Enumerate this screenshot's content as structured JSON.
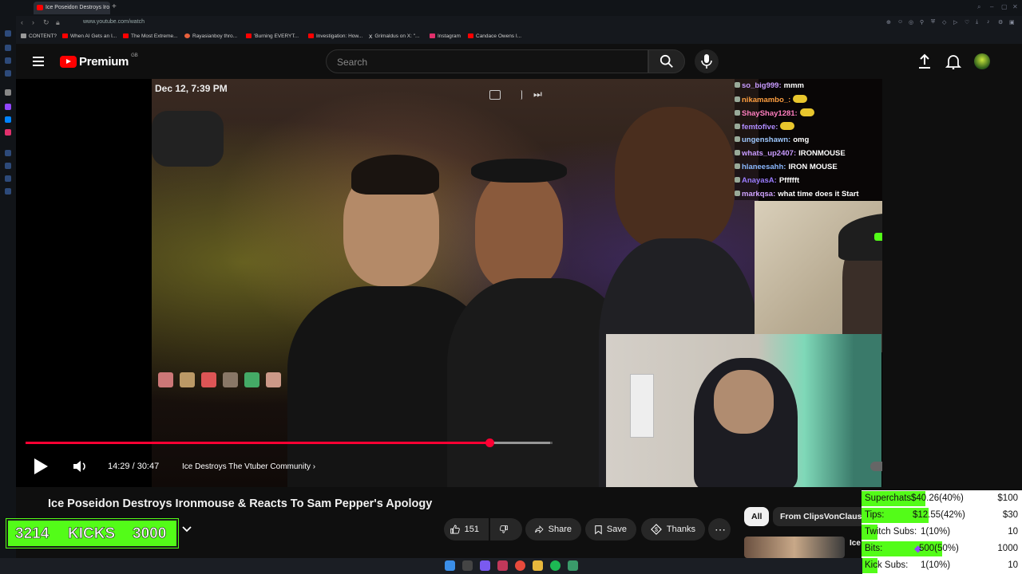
{
  "browser": {
    "tab_title": "Ice Poseidon Destroys Iro",
    "url": "www.youtube.com/watch",
    "bookmarks": [
      {
        "label": "CONTENT?",
        "color": "#bbbbbb"
      },
      {
        "label": "When AI Gets an I...",
        "color": "#ff0000"
      },
      {
        "label": "The Most Extreme...",
        "color": "#ff0000"
      },
      {
        "label": "Rayasianboy thro...",
        "color": "#e8603c"
      },
      {
        "label": "'Burning EVERYT...",
        "color": "#ff0000"
      },
      {
        "label": "Investigation: How...",
        "color": "#ff0000"
      },
      {
        "label": "Grimaldus on X: \"...",
        "color": "#ffffff"
      },
      {
        "label": "Instagram",
        "color": "#e1306c"
      },
      {
        "label": "Candace Owens I...",
        "color": "#ff0000"
      }
    ]
  },
  "header": {
    "logo_text": "Premium",
    "country": "GB",
    "search_placeholder": "Search"
  },
  "video": {
    "overlay_date": "Dec 12, 7:39 PM",
    "time_display": "14:29 / 30:47",
    "chapter": "Ice Destroys The Vtuber Community",
    "progress_played": 0.88,
    "progress_buffered": 0.995,
    "title": "Ice Poseidon Destroys Ironmouse & Reacts To Sam Pepper's Apology"
  },
  "chat": [
    {
      "user": "so_big999:",
      "msg": "mmm",
      "color": "#c89bff",
      "emote": false
    },
    {
      "user": "nikamambo_:",
      "msg": "",
      "color": "#ff9f40",
      "emote": true
    },
    {
      "user": "ShayShay1281:",
      "msg": "",
      "color": "#ff7ec0",
      "emote": true
    },
    {
      "user": "femtofive:",
      "msg": "",
      "color": "#b08cff",
      "emote": true
    },
    {
      "user": "ungenshawn:",
      "msg": "omg",
      "color": "#9ec8ff",
      "emote": false
    },
    {
      "user": "whats_up2407:",
      "msg": "IRONMOUSE",
      "color": "#c89bff",
      "emote": false
    },
    {
      "user": "hlaneesahh:",
      "msg": "IRON MOUSE",
      "color": "#8bb8ff",
      "emote": false
    },
    {
      "user": "AnayasA:",
      "msg": "Pffffft",
      "color": "#9a7cff",
      "emote": false
    },
    {
      "user": "markqsa:",
      "msg": "what time does it Start",
      "color": "#cfa3ff",
      "emote": false
    }
  ],
  "actions": {
    "like_count": "151",
    "share": "Share",
    "save": "Save",
    "thanks": "Thanks"
  },
  "filter_chips": [
    "All",
    "From ClipsVonClaus"
  ],
  "recommended_peek": "Ice",
  "kicks": {
    "count": "3214",
    "label": "KICKS",
    "goal": "3000"
  },
  "goals": [
    {
      "label": "Superchats:",
      "value": "$40.26(40%)",
      "max": "$100",
      "fill": 0.4
    },
    {
      "label": "Tips:",
      "value": "$12.55(42%)",
      "max": "$30",
      "fill": 0.42
    },
    {
      "label": "Twitch Subs:",
      "value": "1(10%)",
      "max": "10",
      "fill": 0.1
    },
    {
      "label": "Bits:",
      "value": "500(50%)",
      "max": "1000",
      "fill": 0.5
    },
    {
      "label": "Kick Subs:",
      "value": "1(10%)",
      "max": "10",
      "fill": 0.1
    }
  ]
}
